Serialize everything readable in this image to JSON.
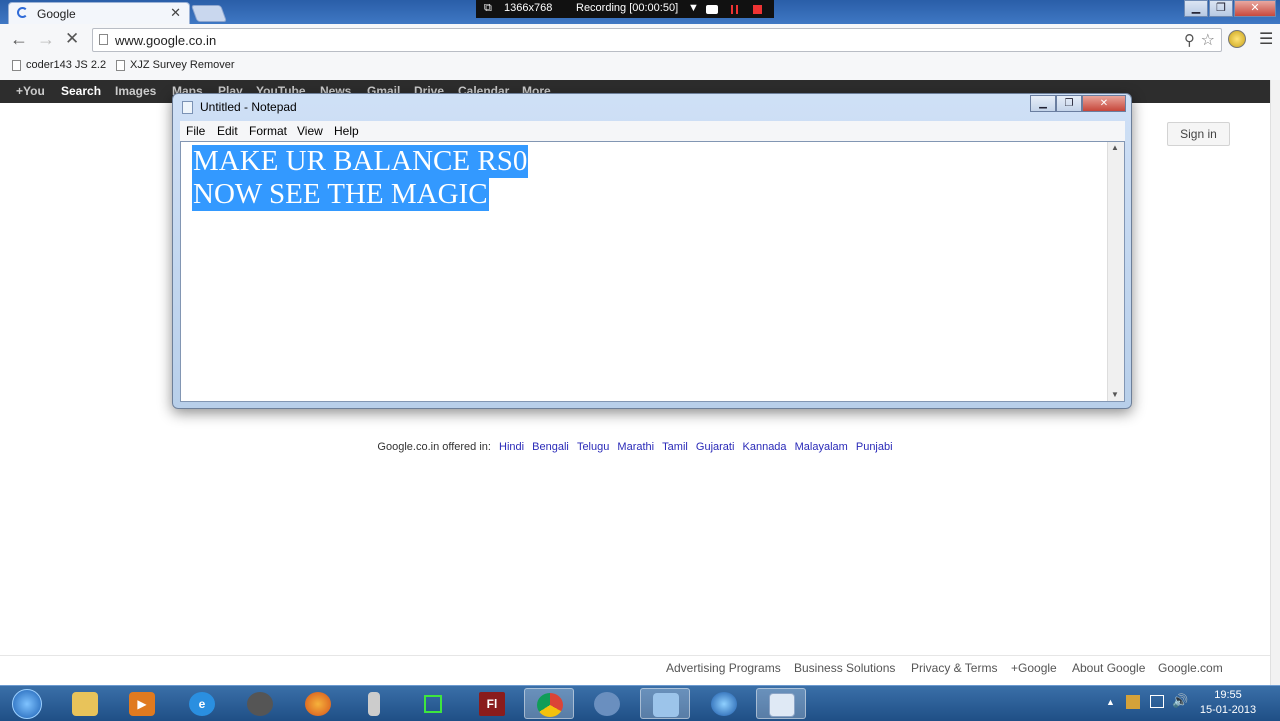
{
  "browser": {
    "tab_title": "Google",
    "tab_close": "✕",
    "url": "www.google.co.in",
    "bookmarks": [
      "coder143 JS 2.2",
      "XJZ Survey Remover"
    ]
  },
  "recorder": {
    "resolution": "1366x768",
    "status": "Recording [00:00:50]"
  },
  "google_bar": {
    "links": [
      "+You",
      "Search",
      "Images",
      "Maps",
      "Play",
      "YouTube",
      "News",
      "Gmail",
      "Drive",
      "Calendar",
      "More"
    ]
  },
  "sign_in": "Sign in",
  "offered": {
    "prefix": "Google.co.in offered in:",
    "languages": [
      "Hindi",
      "Bengali",
      "Telugu",
      "Marathi",
      "Tamil",
      "Gujarati",
      "Kannada",
      "Malayalam",
      "Punjabi"
    ]
  },
  "footer": {
    "links": [
      "Advertising Programs",
      "Business Solutions",
      "Privacy & Terms",
      "+Google",
      "About Google",
      "Google.com"
    ]
  },
  "notepad": {
    "title": "Untitled - Notepad",
    "menu": [
      "File",
      "Edit",
      "Format",
      "View",
      "Help"
    ],
    "lines": [
      "MAKE UR BALANCE RS0",
      "NOW SEE THE MAGIC"
    ]
  },
  "taskbar": {
    "fl_label": "Fl",
    "time": "19:55",
    "date": "15-01-2013"
  },
  "colors": {
    "selection": "#3399ff",
    "google_bar": "#2d2d2d",
    "language_link": "#2a2ab8"
  }
}
